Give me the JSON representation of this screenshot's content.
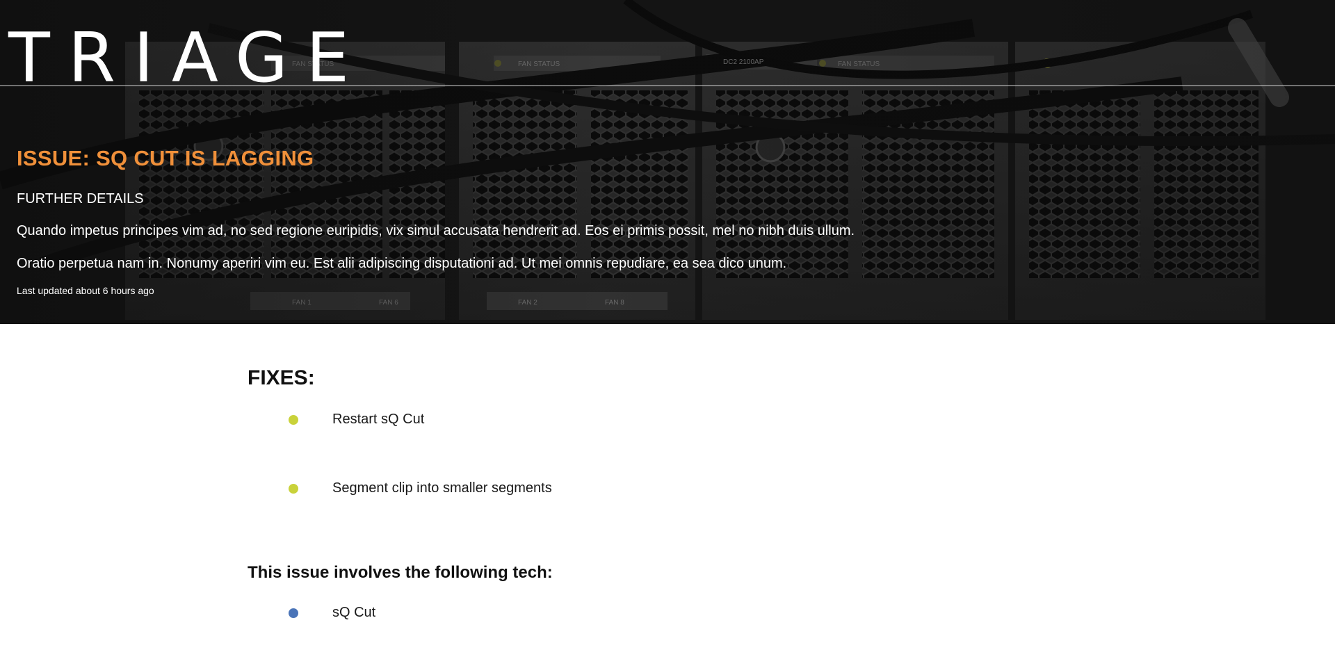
{
  "app": {
    "logo_text": "TRIAGE"
  },
  "issue": {
    "title": "ISSUE: SQ CUT IS LAGGING",
    "details_heading": "FURTHER DETAILS",
    "description": [
      "Quando impetus principes vim ad, no sed regione euripidis, vix simul accusata hendrerit ad. Eos ei primis possit, mel no nibh duis ullum.",
      "Oratio perpetua nam in. Nonumy aperiri vim eu. Est alii adipiscing disputationi ad. Ut mei omnis repudiare, ea sea dico unum."
    ],
    "last_updated": "Last updated about 6 hours ago"
  },
  "fixes": {
    "heading": "FIXES:",
    "items": [
      {
        "label": "Restart sQ Cut"
      },
      {
        "label": "Segment clip into smaller segments"
      }
    ],
    "bullet_color": "#c9d23a"
  },
  "tech": {
    "heading": "This issue involves the following tech:",
    "items": [
      {
        "label": "sQ Cut"
      }
    ],
    "bullet_color": "#4a74b8"
  },
  "colors": {
    "accent_orange": "#f0903a",
    "hero_background": "#151515"
  },
  "hero_image": {
    "labels": [
      "FAN STATUS",
      "FAN STATUS",
      "DC2 2100AP",
      "FAN STATUS",
      "FAN 1",
      "FAN 6",
      "FAN 2",
      "FAN 8"
    ]
  }
}
